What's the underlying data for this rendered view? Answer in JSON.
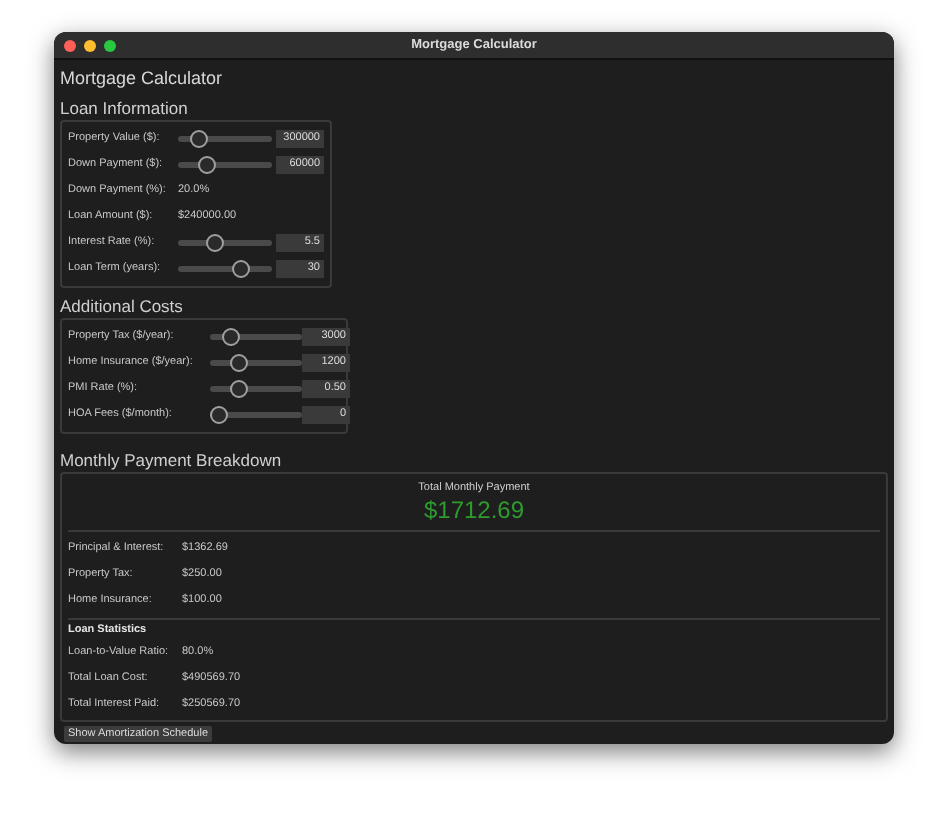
{
  "window": {
    "title": "Mortgage Calculator"
  },
  "heading": "Mortgage Calculator",
  "loan_information": {
    "title": "Loan Information",
    "rows": [
      {
        "kind": "slider",
        "label": "Property Value ($):",
        "level": 0.17,
        "value": "300000"
      },
      {
        "kind": "slider",
        "label": "Down Payment ($):",
        "level": 0.25,
        "value": "60000"
      },
      {
        "kind": "text",
        "label": "Down Payment (%):",
        "value": "20.0%"
      },
      {
        "kind": "text",
        "label": "Loan Amount ($):",
        "value": "$240000.00"
      },
      {
        "kind": "slider",
        "label": "Interest Rate (%):",
        "level": 0.38,
        "value": "5.5"
      },
      {
        "kind": "slider",
        "label": "Loan Term (years):",
        "level": 0.7,
        "value": "30"
      }
    ]
  },
  "additional_costs": {
    "title": "Additional Costs",
    "rows": [
      {
        "kind": "slider",
        "label": "Property Tax ($/year):",
        "level": 0.15,
        "value": "3000"
      },
      {
        "kind": "slider",
        "label": "Home Insurance ($/year):",
        "level": 0.26,
        "value": "1200"
      },
      {
        "kind": "slider",
        "label": "PMI Rate (%):",
        "level": 0.26,
        "value": "0.50"
      },
      {
        "kind": "slider",
        "label": "HOA Fees ($/month):",
        "level": 0,
        "value": "0"
      }
    ]
  },
  "breakdown": {
    "title": "Monthly Payment Breakdown",
    "total_label": "Total Monthly Payment",
    "total_value": "$1712.69",
    "rows": [
      {
        "label": "Principal & Interest:",
        "value": "$1362.69"
      },
      {
        "label": "Property Tax:",
        "value": "$250.00"
      },
      {
        "label": "Home Insurance:",
        "value": "$100.00"
      }
    ],
    "statistics": {
      "title": "Loan Statistics",
      "rows": [
        {
          "label": "Loan-to-Value Ratio:",
          "value": "80.0%"
        },
        {
          "label": "Total Loan Cost:",
          "value": "$490569.70"
        },
        {
          "label": "Total Interest Paid:",
          "value": "$250569.70"
        }
      ]
    }
  },
  "button": "Show Amortization Schedule"
}
